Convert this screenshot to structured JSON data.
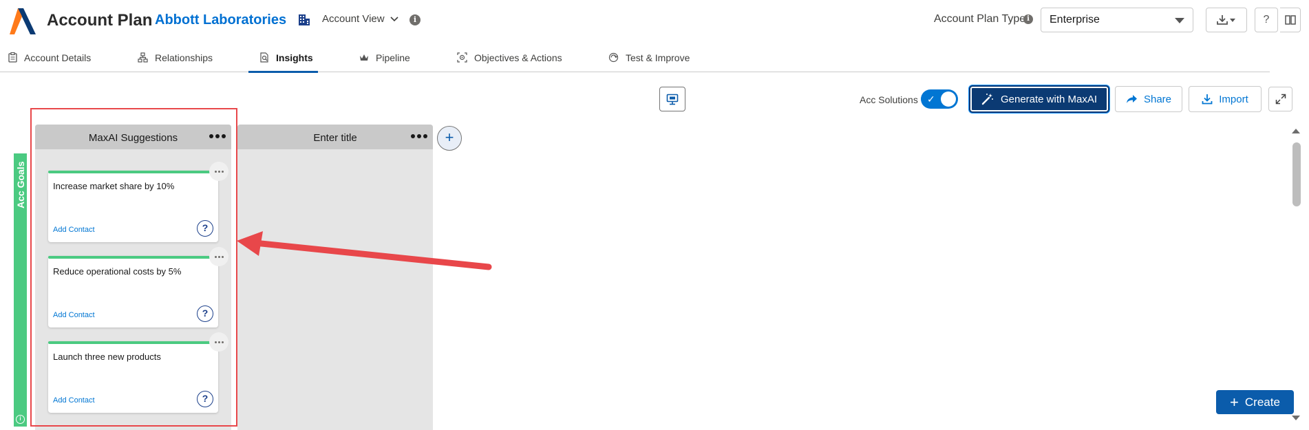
{
  "header": {
    "app_title": "Account Plan",
    "account_name": "Abbott Laboratories",
    "view_select": "Account View",
    "plan_type_label": "Account Plan Type",
    "plan_type_value": "Enterprise"
  },
  "tabs": [
    {
      "label": "Account Details",
      "icon": "clipboard-icon"
    },
    {
      "label": "Relationships",
      "icon": "hierarchy-icon"
    },
    {
      "label": "Insights",
      "icon": "insights-icon",
      "active": true
    },
    {
      "label": "Pipeline",
      "icon": "crown-icon"
    },
    {
      "label": "Objectives & Actions",
      "icon": "target-icon"
    },
    {
      "label": "Test & Improve",
      "icon": "test-icon"
    }
  ],
  "toolbar": {
    "acc_solutions_label": "Acc Solutions",
    "acc_solutions_on": true,
    "generate_label": "Generate with MaxAI",
    "share_label": "Share",
    "import_label": "Import"
  },
  "board": {
    "rail_label": "Acc Goals",
    "columns": [
      {
        "title": "MaxAI Suggestions",
        "cards": [
          {
            "title": "Increase market share by 10%",
            "action": "Add Contact"
          },
          {
            "title": "Reduce operational costs by 5%",
            "action": "Add Contact"
          },
          {
            "title": "Launch three new products",
            "action": "Add Contact"
          }
        ]
      },
      {
        "title": "Enter title",
        "cards": []
      }
    ],
    "add_column_symbol": "+"
  },
  "create_label": "Create",
  "colors": {
    "brand_blue": "#0176d3",
    "dark_blue": "#0b3a73",
    "green": "#4bca81",
    "highlight_red": "#e8474a"
  }
}
